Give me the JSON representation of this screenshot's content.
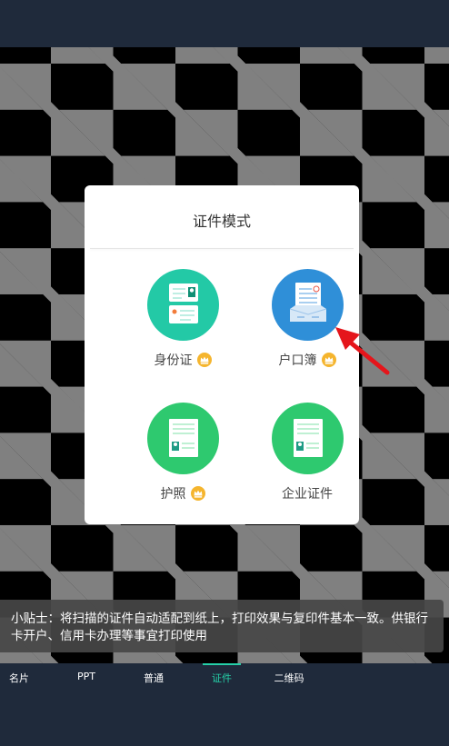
{
  "modal": {
    "title": "证件模式",
    "modes": [
      {
        "label": "身份证",
        "premium": true,
        "icon": "id-card-icon"
      },
      {
        "label": "户口簿",
        "premium": true,
        "icon": "household-register-icon"
      },
      {
        "label": "护照",
        "premium": true,
        "icon": "passport-icon"
      },
      {
        "label": "企业证件",
        "premium": false,
        "icon": "business-license-icon"
      }
    ]
  },
  "tip": "小贴士：将扫描的证件自动适配到纸上，打印效果与复印件基本一致。供银行卡开户、信用卡办理等事宜打印使用",
  "tabs": [
    {
      "label": "名片",
      "active": false
    },
    {
      "label": "PPT",
      "active": false
    },
    {
      "label": "普通",
      "active": false
    },
    {
      "label": "证件",
      "active": true
    },
    {
      "label": "二维码",
      "active": false
    }
  ],
  "colors": {
    "accent": "#25d0a8",
    "id_card": "#23c9a6",
    "household": "#2f8fd8",
    "passport": "#2ec96f",
    "crown": "#f5b52e",
    "arrow": "#e5151b"
  }
}
